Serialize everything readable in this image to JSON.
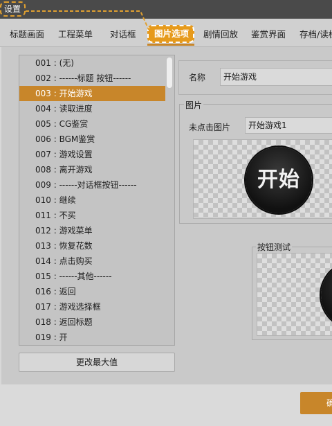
{
  "window": {
    "title": "设置"
  },
  "tabs": [
    {
      "label": "标题画面"
    },
    {
      "label": "工程菜单"
    },
    {
      "label": "对话框"
    },
    {
      "label": "图片选项"
    },
    {
      "label": "剧情回放"
    },
    {
      "label": "鉴赏界面"
    },
    {
      "label": "存档/读档"
    }
  ],
  "active_tab": "图片选项",
  "list": {
    "items": [
      {
        "label": "001 : (无)"
      },
      {
        "label": "002 : ------标题  按钮------"
      },
      {
        "label": "003 : 开始游戏"
      },
      {
        "label": "004 : 读取进度"
      },
      {
        "label": "005 : CG鉴赏"
      },
      {
        "label": "006 : BGM鉴赏"
      },
      {
        "label": "007 : 游戏设置"
      },
      {
        "label": "008 : 离开游戏"
      },
      {
        "label": "009 : ------对话框按钮------"
      },
      {
        "label": "010 : 继续"
      },
      {
        "label": "011 : 不买"
      },
      {
        "label": "012 : 游戏菜单"
      },
      {
        "label": "013 : 恢复花数"
      },
      {
        "label": "014 : 点击购买"
      },
      {
        "label": "015 : ------其他------"
      },
      {
        "label": "016 : 返回"
      },
      {
        "label": "017 : 游戏选择框"
      },
      {
        "label": "018 : 返回标题"
      },
      {
        "label": "019 : 开"
      }
    ],
    "selected_index": 2
  },
  "buttons": {
    "change_max": "更改最大值",
    "ok": "确定"
  },
  "detail": {
    "name_label": "名称",
    "name_value": "开始游戏",
    "image_group_title": "图片",
    "unclicked_label": "未点击图片",
    "unclicked_value": "开始游戏1",
    "preview_text": "开始",
    "test_group_title": "按钮测试"
  },
  "colors": {
    "accent": "#c8862a",
    "highlight": "#e69a1c",
    "titlebar": "#4a4a4a"
  }
}
